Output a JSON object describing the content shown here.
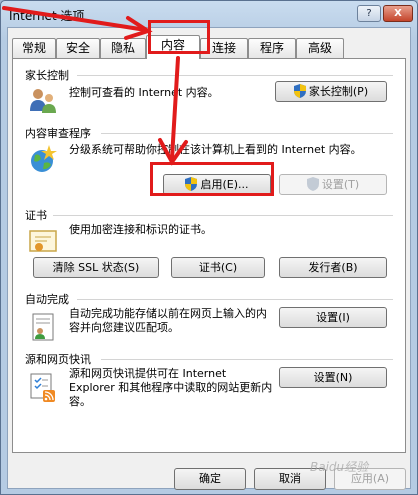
{
  "window": {
    "title": "Internet 选项",
    "help_label": "?",
    "close_label": "X"
  },
  "tabs": [
    {
      "label": "常规"
    },
    {
      "label": "安全"
    },
    {
      "label": "隐私"
    },
    {
      "label": "内容"
    },
    {
      "label": "连接"
    },
    {
      "label": "程序"
    },
    {
      "label": "高级"
    }
  ],
  "active_tab": "内容",
  "sections": {
    "parental": {
      "label": "家长控制",
      "desc": "控制可查看的 Internet 内容。",
      "button": "家长控制(P)"
    },
    "content_advisor": {
      "label": "内容审查程序",
      "desc": "分级系统可帮助你控制在该计算机上看到的 Internet 内容。",
      "enable_button": "启用(E)...",
      "settings_button": "设置(T)"
    },
    "certificates": {
      "label": "证书",
      "desc": "使用加密连接和标识的证书。",
      "clear_ssl_button": "清除 SSL 状态(S)",
      "certs_button": "证书(C)",
      "publishers_button": "发行者(B)"
    },
    "autocomplete": {
      "label": "自动完成",
      "desc": "自动完成功能存储以前在网页上输入的内容并向您建议匹配项。",
      "settings_button": "设置(I)"
    },
    "feeds": {
      "label": "源和网页快讯",
      "desc": "源和网页快讯提供可在 Internet Explorer 和其他程序中读取的网站更新内容。",
      "settings_button": "设置(N)"
    }
  },
  "footer": {
    "ok": "确定",
    "cancel": "取消",
    "apply": "应用(A)"
  },
  "watermark": "Baidu经验",
  "colors": {
    "annotation_red": "#e11b1b",
    "titlebar": "#b5cbe3"
  }
}
